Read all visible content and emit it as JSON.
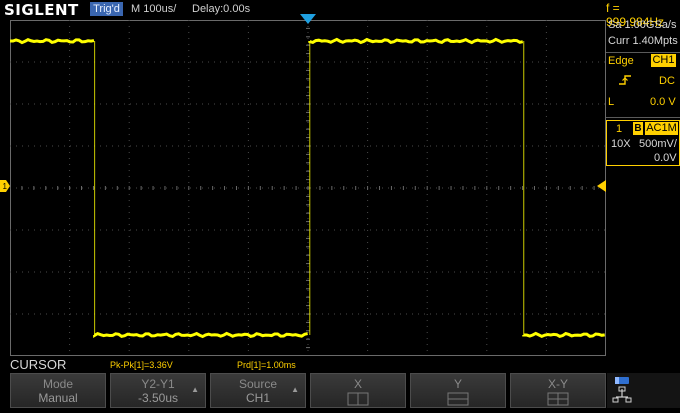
{
  "header": {
    "logo": "SIGLENT",
    "trigger_state": "Trig'd",
    "timebase": "M 100us/",
    "delay": "Delay:0.00s",
    "frequency": "f = 999.984Hz"
  },
  "acquisition": {
    "sample_rate": "Sa 1.00GSa/s",
    "memory_depth": "Curr 1.40Mpts"
  },
  "trigger": {
    "type": "Edge",
    "source": "CH1",
    "slope_icon": "rising-edge-icon",
    "coupling": "DC",
    "level_label": "L",
    "level": "0.0 V"
  },
  "channel1": {
    "number": "1",
    "bw_limit": "B",
    "coupling": "AC1M",
    "probe": "10X",
    "scale": "500mV/",
    "offset": "0.0V",
    "color": "#ffff00"
  },
  "measurements": {
    "menu_title": "CURSOR",
    "pkpk": "Pk-Pk[1]=3.36V",
    "period": "Prd[1]=1.00ms"
  },
  "softkeys": [
    {
      "line1": "Mode",
      "line2": "Manual"
    },
    {
      "line1": "Y2-Y1",
      "line2": "-3.50us"
    },
    {
      "line1": "Source",
      "line2": "CH1"
    },
    {
      "line1": "X",
      "line2": ""
    },
    {
      "line1": "Y",
      "line2": ""
    },
    {
      "line1": "X-Y",
      "line2": ""
    }
  ],
  "waveform": {
    "high_level": 1.75,
    "low_level": -1.75,
    "volts_per_div": 0.5,
    "segments": [
      {
        "from_div": 0.0,
        "to_div": 1.42,
        "state": "high"
      },
      {
        "from_div": 1.42,
        "to_div": 5.03,
        "state": "low"
      },
      {
        "from_div": 5.03,
        "to_div": 8.62,
        "state": "high"
      },
      {
        "from_div": 8.62,
        "to_div": 10.0,
        "state": "low"
      }
    ]
  }
}
